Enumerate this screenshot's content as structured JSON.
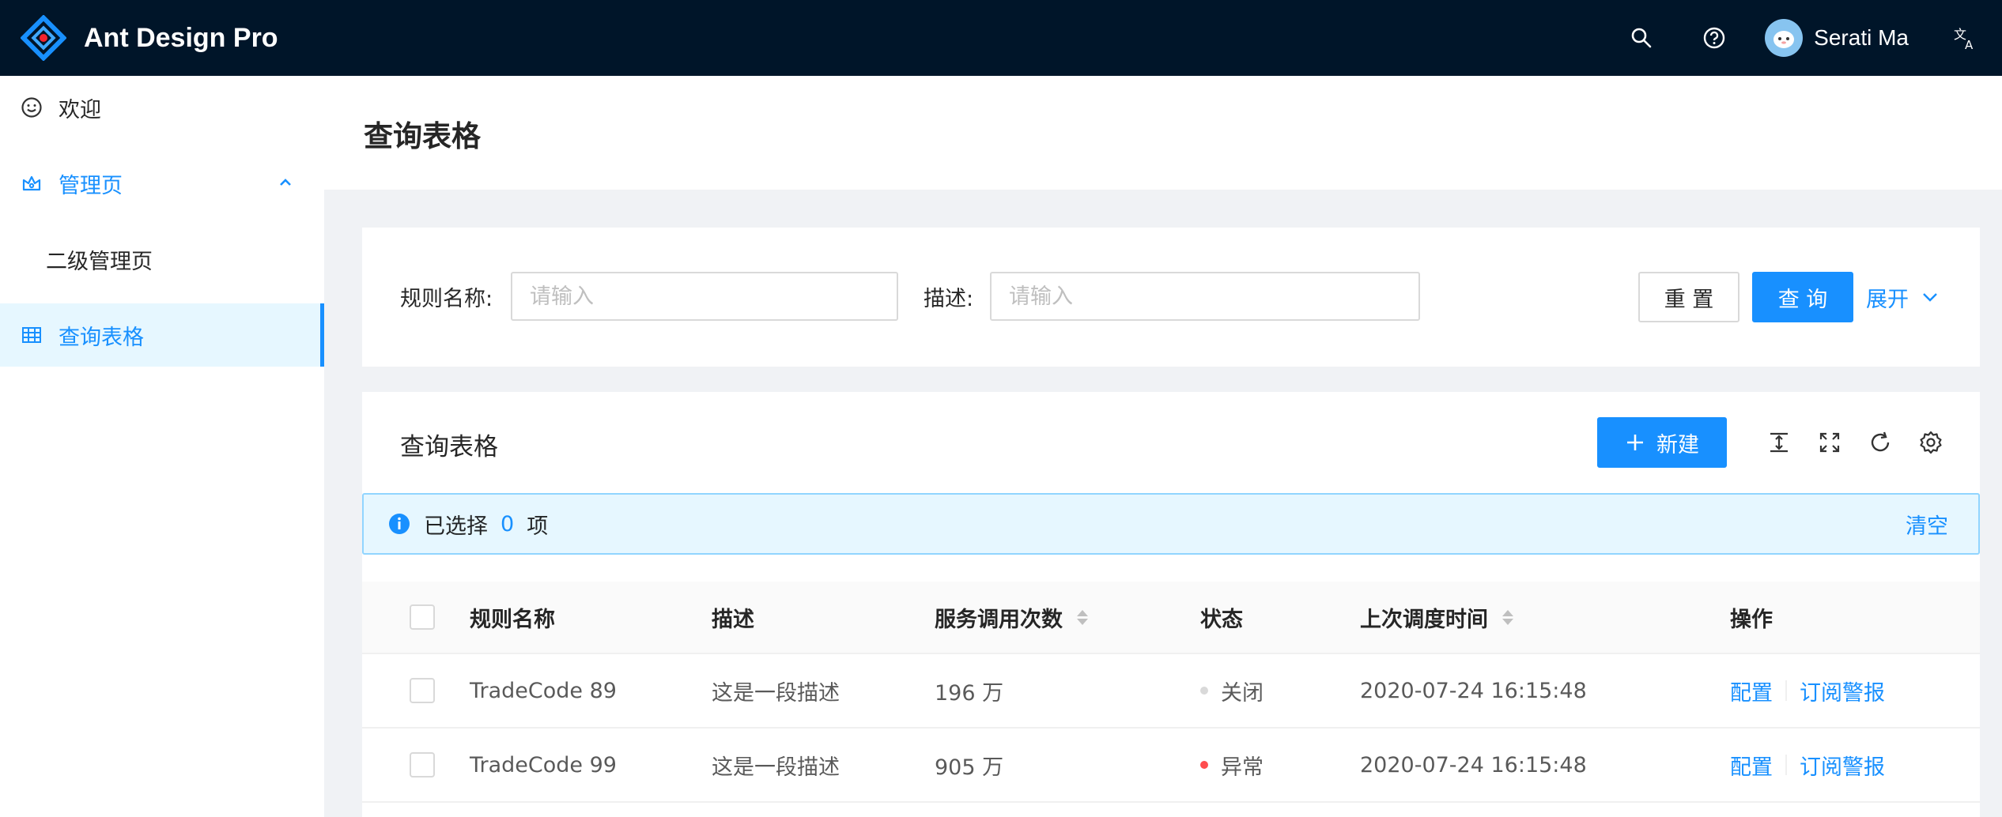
{
  "header": {
    "app_title": "Ant Design Pro",
    "user_name": "Serati Ma",
    "icons": [
      "search-icon",
      "question-circle-icon",
      "translate-icon"
    ]
  },
  "sidebar": {
    "items": [
      {
        "label": "欢迎",
        "icon": "smile-icon"
      },
      {
        "label": "管理页",
        "icon": "crown-icon",
        "open": true
      },
      {
        "label": "二级管理页",
        "icon": ""
      },
      {
        "label": "查询表格",
        "icon": "table-icon",
        "selected": true
      }
    ]
  },
  "page": {
    "title": "查询表格"
  },
  "search": {
    "rule_name_label": "规则名称:",
    "rule_name_placeholder": "请输入",
    "desc_label": "描述:",
    "desc_placeholder": "请输入",
    "reset_label": "重 置",
    "query_label": "查 询",
    "expand_label": "展开"
  },
  "table": {
    "title": "查询表格",
    "new_label": "新建",
    "alert": {
      "prefix": "已选择",
      "count": "0",
      "suffix": "项",
      "clear": "清空"
    },
    "columns": [
      "规则名称",
      "描述",
      "服务调用次数",
      "状态",
      "上次调度时间",
      "操作"
    ],
    "rows": [
      {
        "name": "TradeCode 89",
        "desc": "这是一段描述",
        "calls": "196 万",
        "status": "关闭",
        "status_color": "#d9d9d9",
        "time": "2020-07-24 16:15:48",
        "op1": "配置",
        "op2": "订阅警报"
      },
      {
        "name": "TradeCode 99",
        "desc": "这是一段描述",
        "calls": "905 万",
        "status": "异常",
        "status_color": "#ff4d4f",
        "time": "2020-07-24 16:15:48",
        "op1": "配置",
        "op2": "订阅警报"
      }
    ]
  },
  "colors": {
    "primary": "#1890ff",
    "header_bg": "#001529"
  }
}
